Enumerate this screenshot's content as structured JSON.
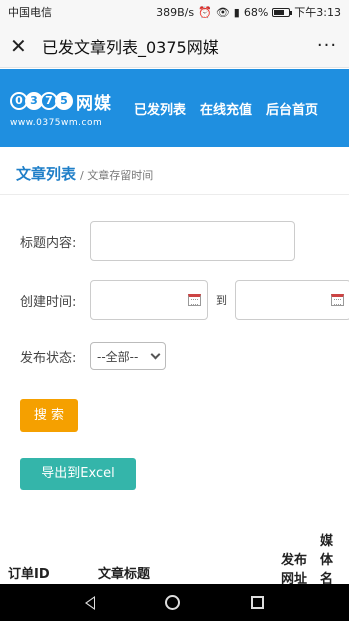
{
  "status_bar": {
    "carrier": "中国电信",
    "speed": "389B/s",
    "battery": "68%",
    "battery_level": 0.68,
    "time": "下午3:13"
  },
  "title_bar": {
    "close_glyph": "✕",
    "title": "已发文章列表_0375网媒",
    "more_glyph": "···"
  },
  "site": {
    "logo_digits": [
      "0",
      "3",
      "7",
      "5"
    ],
    "logo_cn": "网媒",
    "logo_url": "www.0375wm.com",
    "nav": [
      "已发列表",
      "在线充值",
      "后台首页"
    ]
  },
  "breadcrumb": {
    "main": "文章列表",
    "sub": "/ 文章存留时间"
  },
  "form": {
    "title_label": "标题内容:",
    "title_value": "",
    "created_label": "创建时间:",
    "date_from": "",
    "date_to": "",
    "to_label": "到",
    "status_label": "发布状态:",
    "status_selected": "--全部--",
    "search_button": "搜 索",
    "export_button": "导出到Excel"
  },
  "table": {
    "headers": [
      "订单ID",
      "文章标题",
      "发布网址",
      "媒体名"
    ]
  },
  "colors": {
    "header_blue": "#1f8fe0",
    "search_orange": "#f5a000",
    "export_teal": "#34b5aa",
    "crumb_blue": "#1f7fc8"
  }
}
